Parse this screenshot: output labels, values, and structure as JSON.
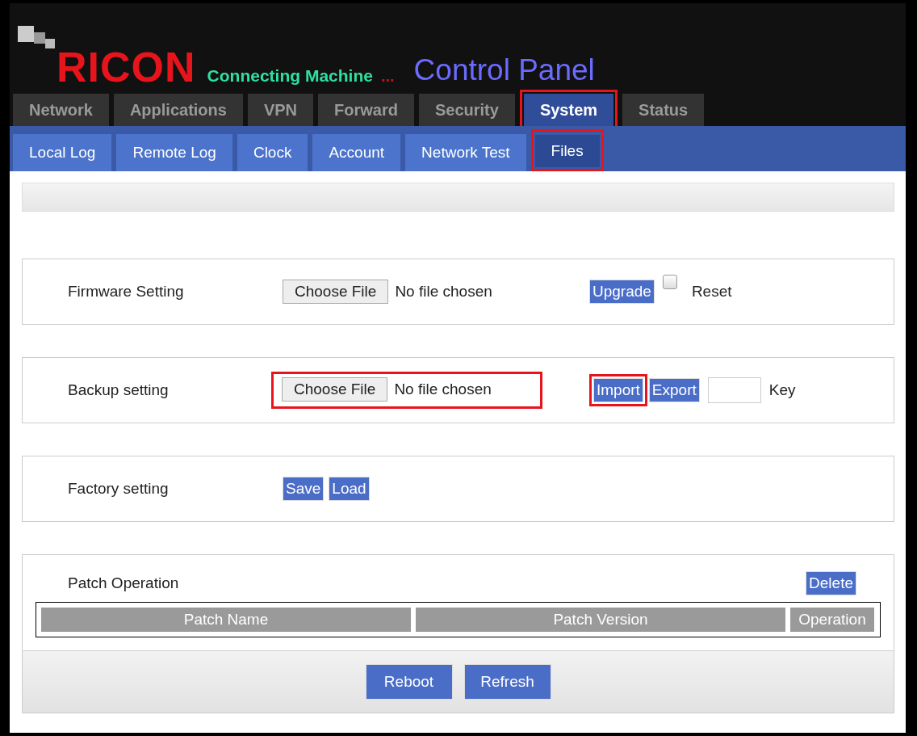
{
  "header": {
    "brand": "RICON",
    "tagline": "Connecting Machine",
    "ellipsis": "...",
    "title": "Control Panel"
  },
  "tabs": [
    {
      "label": "Network",
      "selected": false,
      "highlighted": false
    },
    {
      "label": "Applications",
      "selected": false,
      "highlighted": false
    },
    {
      "label": "VPN",
      "selected": false,
      "highlighted": false
    },
    {
      "label": "Forward",
      "selected": false,
      "highlighted": false
    },
    {
      "label": "Security",
      "selected": false,
      "highlighted": false
    },
    {
      "label": "System",
      "selected": true,
      "highlighted": true
    },
    {
      "label": "Status",
      "selected": false,
      "highlighted": false
    }
  ],
  "subtabs": [
    {
      "label": "Local Log",
      "selected": false,
      "highlighted": false
    },
    {
      "label": "Remote Log",
      "selected": false,
      "highlighted": false
    },
    {
      "label": "Clock",
      "selected": false,
      "highlighted": false
    },
    {
      "label": "Account",
      "selected": false,
      "highlighted": false
    },
    {
      "label": "Network Test",
      "selected": false,
      "highlighted": false
    },
    {
      "label": "Files",
      "selected": true,
      "highlighted": true
    }
  ],
  "sections": [
    {
      "kind": "file",
      "label": "Firmware Setting",
      "file_button": "Choose File",
      "file_status": "No file chosen",
      "highlighted": false,
      "buttons": [
        {
          "label": "Upgrade",
          "highlighted": false
        }
      ],
      "checkbox": {
        "label": "Reset",
        "checked": false
      }
    },
    {
      "kind": "file",
      "label": "Backup setting",
      "file_button": "Choose File",
      "file_status": "No file chosen",
      "highlighted": true,
      "buttons": [
        {
          "label": "Import",
          "highlighted": true
        },
        {
          "label": "Export",
          "highlighted": false
        }
      ],
      "key_field": {
        "label": "Key"
      }
    },
    {
      "kind": "buttons",
      "label": "Factory setting",
      "buttons": [
        {
          "label": "Save",
          "highlighted": false
        },
        {
          "label": "Load",
          "highlighted": false
        }
      ]
    },
    {
      "kind": "table",
      "label": "Patch Operation",
      "buttons": [
        {
          "label": "Delete",
          "highlighted": false
        }
      ],
      "columns": [
        "Patch Name",
        "Patch Version",
        "Operation"
      ]
    }
  ],
  "footer_buttons": [
    "Reboot",
    "Refresh"
  ]
}
